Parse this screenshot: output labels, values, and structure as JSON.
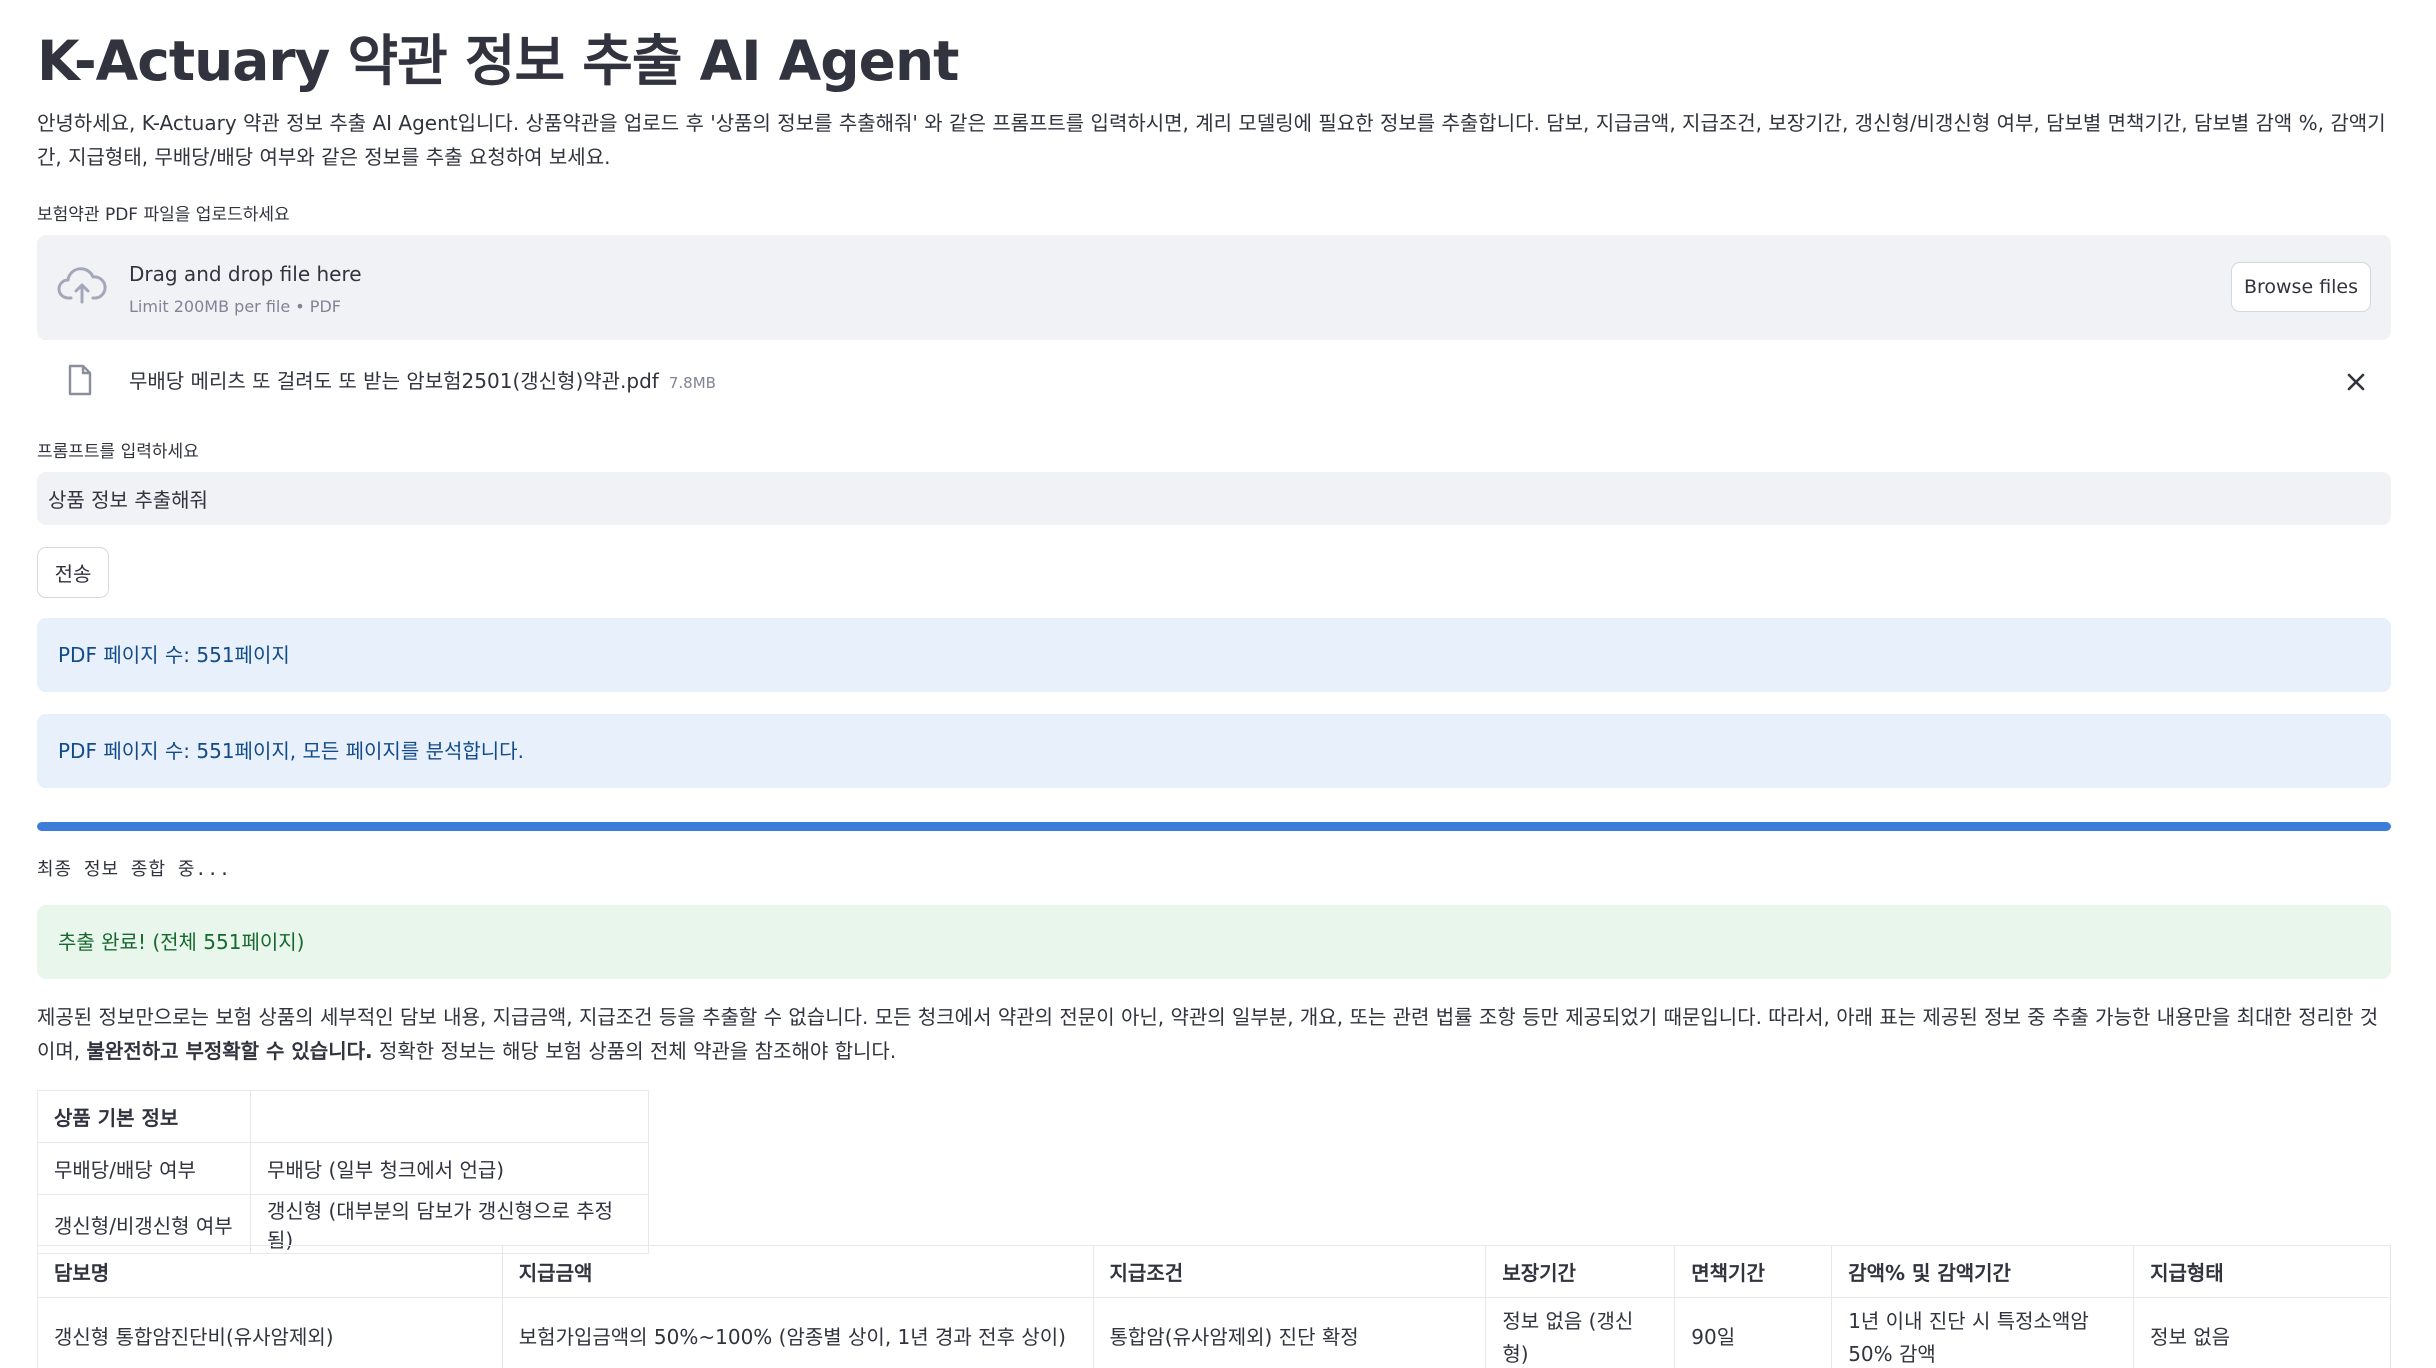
{
  "app": {
    "title": "K-Actuary 약관 정보 추출 AI Agent",
    "intro": "안녕하세요, K-Actuary 약관 정보 추출 AI Agent입니다. 상품약관을 업로드 후 '상품의 정보를 추출해줘' 와 같은 프롬프트를 입력하시면, 계리 모델링에 필요한 정보를 추출합니다. 담보, 지급금액, 지급조건, 보장기간, 갱신형/비갱신형 여부, 담보별 면책기간, 담보별 감액 %, 감액기간, 지급형태, 무배당/배당 여부와 같은 정보를 추출 요청하여 보세요."
  },
  "uploader": {
    "label": "보험약관 PDF 파일을 업로드하세요",
    "drag_text": "Drag and drop file here",
    "limit_text": "Limit 200MB per file • PDF",
    "browse_label": "Browse files",
    "file": {
      "name": "무배당 메리츠 또 걸려도 또 받는 암보험2501(갱신형)약관.pdf",
      "size": "7.8MB"
    }
  },
  "prompt": {
    "label": "프롬프트를 입력하세요",
    "value": "상품 정보 추출해줘"
  },
  "send_label": "전송",
  "alerts": {
    "page_count": "PDF 페이지 수: 551페이지",
    "analyzing": "PDF 페이지 수: 551페이지, 모든 페이지를 분석합니다.",
    "done": "추출 완료! (전체 551페이지)"
  },
  "progress": {
    "value": 1.0,
    "status": "최종 정보 종합 중..."
  },
  "summary": {
    "text1": "제공된 정보만으로는 보험 상품의 세부적인 담보 내용, 지급금액, 지급조건 등을 추출할 수 없습니다. 모든 청크에서 약관의 전문이 아닌, 약관의 일부분, 개요, 또는 관련 법률 조항 등만 제공되었기 때문입니다. 따라서, 아래 표는 제공된 정보 중 추출 가능한 내용만을 최대한 정리한 것이며, ",
    "bold": "불완전하고 부정확할 수 있습니다.",
    "text2": " 정확한 정보는 해당 보험 상품의 전체 약관을 참조해야 합니다."
  },
  "basic_info": {
    "header": "상품 기본 정보",
    "rows": [
      {
        "label": "무배당/배당 여부",
        "value": "무배당 (일부 청크에서 언급)"
      },
      {
        "label": "갱신형/비갱신형 여부",
        "value": "갱신형 (대부분의 담보가 갱신형으로 추정됨)"
      }
    ]
  },
  "coverage_table": {
    "headers": [
      "담보명",
      "지급금액",
      "지급조건",
      "보장기간",
      "면책기간",
      "감액% 및 감액기간",
      "지급형태"
    ],
    "rows": [
      [
        "갱신형 통합암진단비(유사암제외)",
        "보험가입금액의 50%~100% (암종별 상이, 1년 경과 전후 상이)",
        "통합암(유사암제외) 진단 확정",
        "정보 없음 (갱신형)",
        "90일",
        "1년 이내 진단 시 특정소액암 50% 감액",
        "정보 없음"
      ]
    ]
  }
}
